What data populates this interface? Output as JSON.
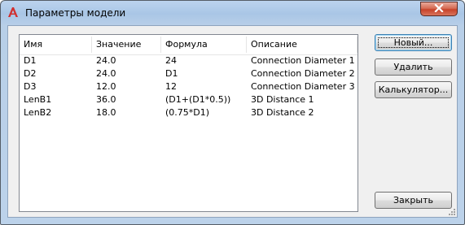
{
  "window": {
    "title": "Параметры модели"
  },
  "list": {
    "columns": [
      "Имя",
      "Значение",
      "Формула",
      "Описание"
    ],
    "rows": [
      [
        "D1",
        "24.0",
        "24",
        "Connection Diameter 1"
      ],
      [
        "D2",
        "24.0",
        "D1",
        "Connection Diameter 2"
      ],
      [
        "D3",
        "12.0",
        "12",
        "Connection Diameter 3"
      ],
      [
        "LenB1",
        "36.0",
        "(D1+(D1*0.5))",
        "3D Distance 1"
      ],
      [
        "LenB2",
        "18.0",
        "(0.75*D1)",
        "3D Distance 2"
      ]
    ]
  },
  "buttons": {
    "new": "Новый...",
    "delete": "Удалить",
    "calculator": "Калькулятор...",
    "close": "Закрыть"
  },
  "icons": {
    "app": "autocad-logo-icon",
    "close": "close-icon",
    "grip": "resize-grip-icon"
  },
  "colors": {
    "app_icon_red": "#d12f2f",
    "close_button": "#c7432a",
    "titlebar": "#a9c6e6"
  }
}
